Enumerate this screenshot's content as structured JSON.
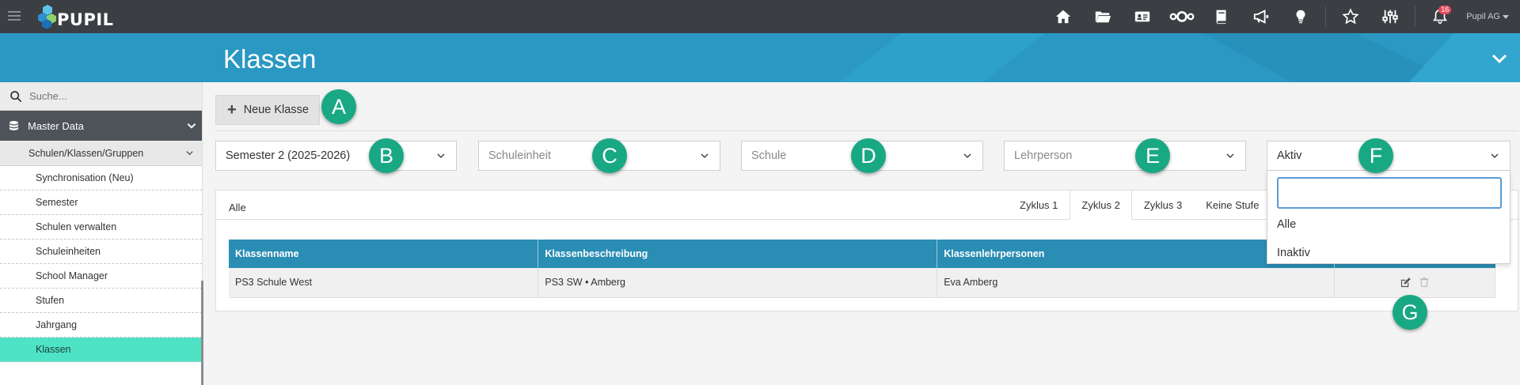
{
  "app": {
    "logo_text": "PUPIL",
    "user_label": "Pupil AG",
    "notification_count": "16"
  },
  "topbar": {
    "icons": [
      "home-icon",
      "folder-icon",
      "id-card-icon",
      "nextcloud-icon",
      "book-icon",
      "megaphone-icon",
      "lightbulb-icon",
      "star-icon",
      "sliders-icon",
      "bell-icon"
    ]
  },
  "header": {
    "title": "Klassen"
  },
  "sidebar": {
    "search_placeholder": "Suche...",
    "master_label": "Master Data",
    "group_label": "Schulen/Klassen/Gruppen",
    "items": [
      {
        "label": "Synchronisation (Neu)"
      },
      {
        "label": "Semester"
      },
      {
        "label": "Schulen verwalten"
      },
      {
        "label": "Schuleinheiten"
      },
      {
        "label": "School Manager"
      },
      {
        "label": "Stufen"
      },
      {
        "label": "Jahrgang"
      },
      {
        "label": "Klassen"
      }
    ]
  },
  "toolbar": {
    "new_button": "Neue Klasse"
  },
  "filters": {
    "semester": "Semester 2 (2025-2026)",
    "schuleinheit_placeholder": "Schuleinheit",
    "schule_placeholder": "Schule",
    "lehrperson_placeholder": "Lehrperson",
    "status": "Aktiv",
    "status_options": [
      "Alle",
      "Inaktiv"
    ]
  },
  "tabs": {
    "alle": "Alle",
    "items": [
      "Zyklus 1",
      "Zyklus 2",
      "Zyklus 3",
      "Keine Stufe"
    ],
    "active": "Zyklus 2"
  },
  "table": {
    "headers": [
      "Klassenname",
      "Klassenbeschreibung",
      "Klassenlehrpersonen",
      ""
    ],
    "rows": [
      {
        "name": "PS3 Schule West",
        "description": "PS3 SW • Amberg",
        "teachers": "Eva Amberg"
      }
    ]
  },
  "callouts": [
    "A",
    "B",
    "C",
    "D",
    "E",
    "F",
    "G"
  ],
  "colors": {
    "topbar": "#3b3e43",
    "header": "#2a98c2",
    "accent": "#19a884",
    "active_item": "#4fe3c5",
    "table_header": "#2a8db4"
  }
}
